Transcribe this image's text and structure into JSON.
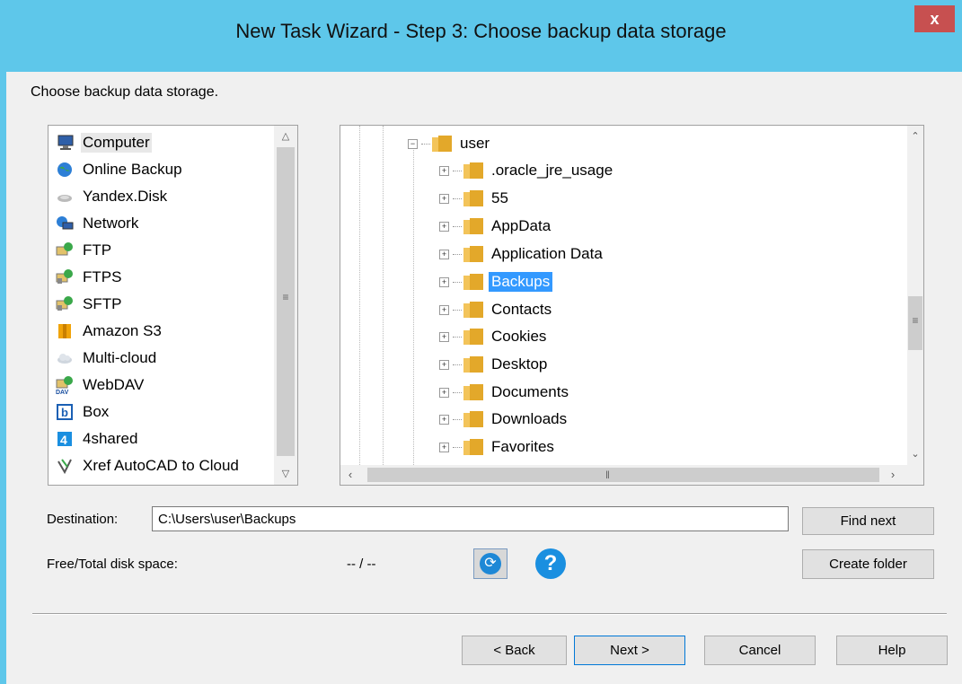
{
  "window": {
    "title": "New Task Wizard - Step 3: Choose backup data storage",
    "close_label": "x"
  },
  "instruction": "Choose backup data storage.",
  "storage_list": {
    "items": [
      {
        "label": "Computer",
        "icon": "computer-icon",
        "selected": true
      },
      {
        "label": "Online Backup",
        "icon": "globe-icon"
      },
      {
        "label": "Yandex.Disk",
        "icon": "yandex-disk-icon"
      },
      {
        "label": "Network",
        "icon": "network-icon"
      },
      {
        "label": "FTP",
        "icon": "ftp-icon"
      },
      {
        "label": "FTPS",
        "icon": "ftps-icon"
      },
      {
        "label": "SFTP",
        "icon": "sftp-icon"
      },
      {
        "label": "Amazon S3",
        "icon": "amazon-s3-icon"
      },
      {
        "label": "Multi-cloud",
        "icon": "cloud-icon"
      },
      {
        "label": "WebDAV",
        "icon": "webdav-icon"
      },
      {
        "label": "Box",
        "icon": "box-icon"
      },
      {
        "label": "4shared",
        "icon": "4shared-icon"
      },
      {
        "label": "Xref AutoCAD to Cloud",
        "icon": "xref-icon"
      }
    ]
  },
  "folder_tree": {
    "root": {
      "label": "user",
      "expanded": true
    },
    "items": [
      {
        "label": ".oracle_jre_usage"
      },
      {
        "label": "55"
      },
      {
        "label": "AppData"
      },
      {
        "label": "Application Data"
      },
      {
        "label": "Backups",
        "selected": true
      },
      {
        "label": "Contacts"
      },
      {
        "label": "Cookies"
      },
      {
        "label": "Desktop"
      },
      {
        "label": "Documents"
      },
      {
        "label": "Downloads"
      },
      {
        "label": "Favorites"
      }
    ]
  },
  "destination": {
    "label": "Destination:",
    "value": "C:\\Users\\user\\Backups"
  },
  "disk_space": {
    "label": "Free/Total disk space:",
    "value": "-- / --"
  },
  "buttons": {
    "find_next": "Find next",
    "create_folder": "Create folder",
    "back": "< Back",
    "next": "Next >",
    "cancel": "Cancel",
    "help": "Help"
  },
  "icons": {
    "refresh": "refresh-icon",
    "help": "help-icon"
  }
}
